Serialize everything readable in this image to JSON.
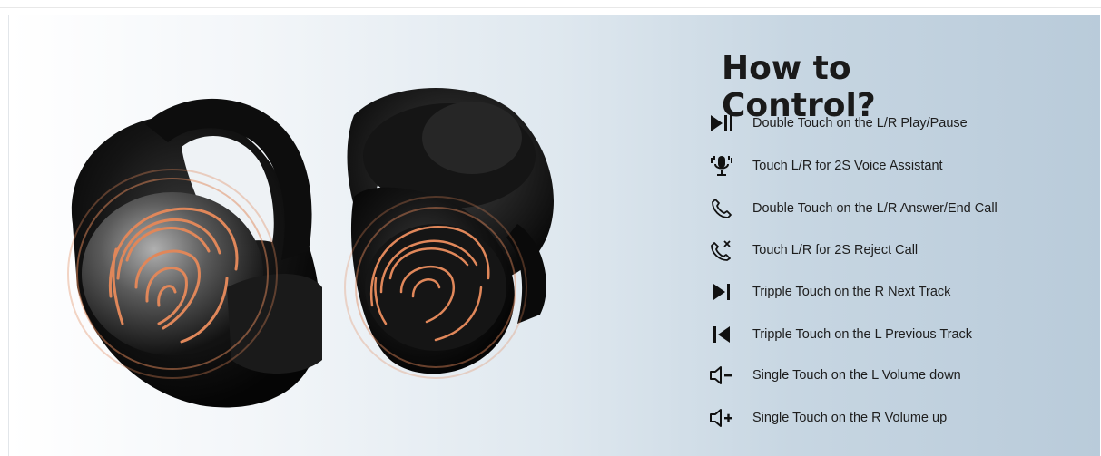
{
  "title": "How to Control?",
  "controls": [
    {
      "icon": "play-pause-icon",
      "label": "Double Touch on the L/R Play/Pause"
    },
    {
      "icon": "voice-assistant-icon",
      "label": "Touch L/R for 2S Voice Assistant"
    },
    {
      "icon": "phone-icon",
      "label": "Double Touch on the L/R Answer/End Call"
    },
    {
      "icon": "reject-call-icon",
      "label": "Touch L/R for 2S Reject Call"
    },
    {
      "icon": "next-track-icon",
      "label": "Tripple Touch on the R Next Track"
    },
    {
      "icon": "previous-track-icon",
      "label": "Tripple Touch on the L Previous Track"
    },
    {
      "icon": "volume-down-icon",
      "label": "Single Touch on the L Volume down"
    },
    {
      "icon": "volume-up-icon",
      "label": "Single Touch on the R Volume up"
    }
  ],
  "colors": {
    "fingerprint": "#e0875a",
    "earbud": "#111111",
    "text": "#1d1d1d"
  }
}
